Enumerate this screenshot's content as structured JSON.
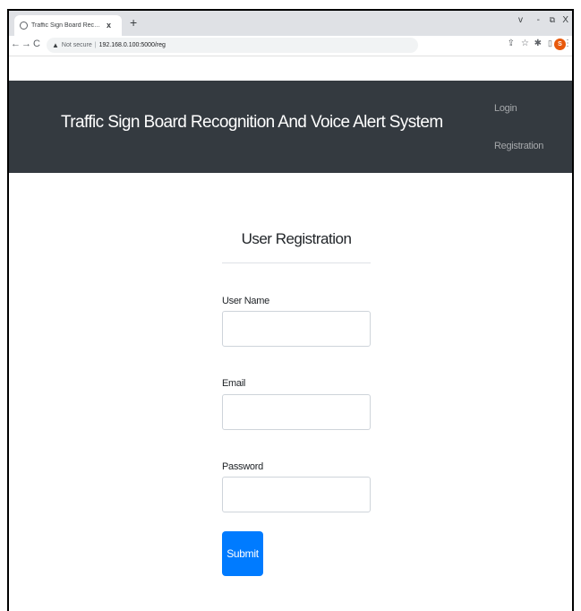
{
  "browser": {
    "tab_title": "Traffic Sign Board Recognition A",
    "tab_close": "x",
    "new_tab": "+",
    "window_controls": {
      "chevron": "v",
      "minimize": "-",
      "maximize": "⧉",
      "close": "X"
    },
    "nav": {
      "back": "←",
      "forward": "→",
      "reload": "C"
    },
    "security_label": "Not secure",
    "separator": "|",
    "url": "192.168.0.100:5000/reg",
    "toolbar_icons": [
      "share-icon",
      "star-icon",
      "extensions-icon",
      "side-panel-icon"
    ],
    "profile_initial": "S",
    "menu": "⋮"
  },
  "header": {
    "brand": "Traffic Sign Board Recognition And Voice Alert System",
    "nav": [
      "Login",
      "Registration"
    ]
  },
  "form": {
    "title": "User Registration",
    "fields": [
      {
        "label": "User Name",
        "value": "",
        "placeholder": ""
      },
      {
        "label": "Email",
        "value": "",
        "placeholder": ""
      },
      {
        "label": "Password",
        "value": "",
        "placeholder": ""
      }
    ],
    "submit_label": "Submit"
  },
  "colors": {
    "header_bg": "#343a40",
    "primary": "#007bff",
    "avatar": "#e8590c"
  }
}
